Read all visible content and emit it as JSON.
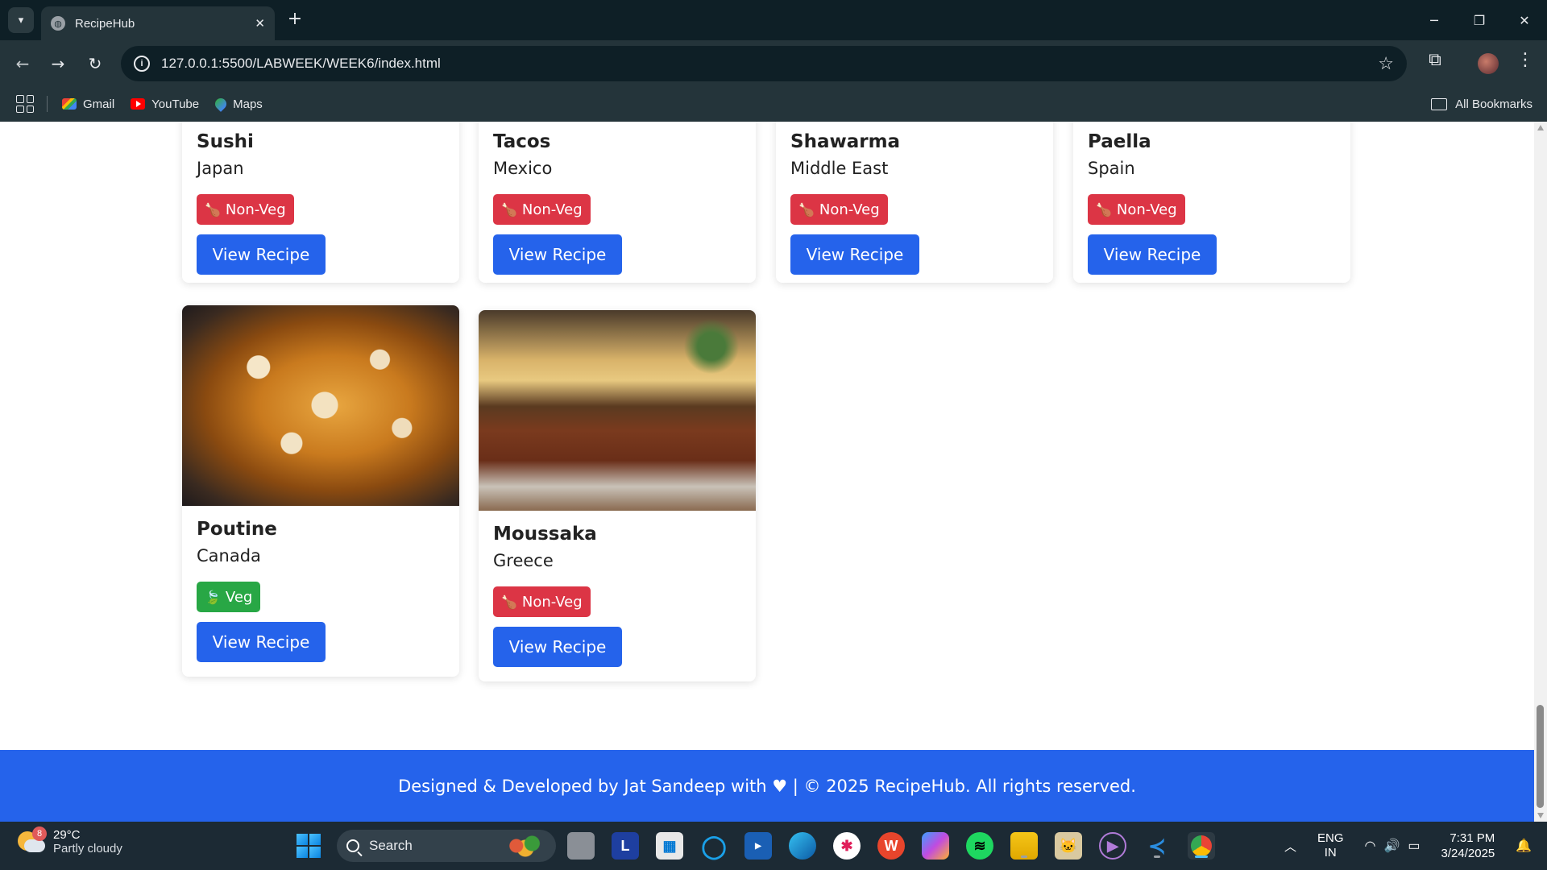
{
  "browser": {
    "tab_title": "RecipeHub",
    "url": "127.0.0.1:5500/LABWEEK/WEEK6/index.html",
    "bookmarks": [
      {
        "label": "Gmail",
        "icon": "gmail-icon"
      },
      {
        "label": "YouTube",
        "icon": "youtube-icon"
      },
      {
        "label": "Maps",
        "icon": "maps-icon"
      }
    ],
    "all_bookmarks_label": "All Bookmarks"
  },
  "recipes_top_row": [
    {
      "name": "Sushi",
      "country": "Japan",
      "badge": "Non-Veg"
    },
    {
      "name": "Tacos",
      "country": "Mexico",
      "badge": "Non-Veg"
    },
    {
      "name": "Shawarma",
      "country": "Middle East",
      "badge": "Non-Veg"
    },
    {
      "name": "Paella",
      "country": "Spain",
      "badge": "Non-Veg"
    }
  ],
  "recipes_bottom_row": [
    {
      "name": "Poutine",
      "country": "Canada",
      "badge": "Veg"
    },
    {
      "name": "Moussaka",
      "country": "Greece",
      "badge": "Non-Veg"
    }
  ],
  "view_recipe_label": "View Recipe",
  "footer_text": "Designed & Developed by Jat Sandeep with ♥ | © 2025 RecipeHub. All rights reserved.",
  "taskbar": {
    "weather_badge": "8",
    "temperature": "29°C",
    "weather_desc": "Partly cloudy",
    "search_label": "Search",
    "lang_line1": "ENG",
    "lang_line2": "IN",
    "time": "7:31 PM",
    "date": "3/24/2025"
  },
  "colors": {
    "primary_blue": "#2563eb",
    "nonveg_red": "#dc3545",
    "veg_green": "#28a745"
  }
}
